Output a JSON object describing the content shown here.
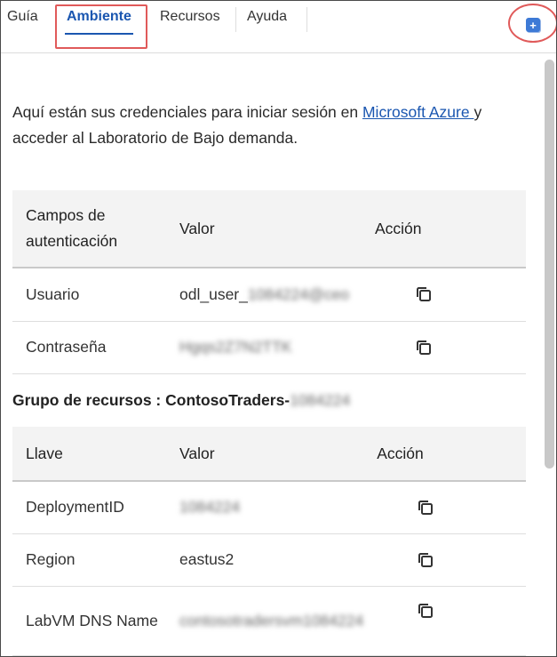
{
  "tabs": [
    {
      "label": "Guía"
    },
    {
      "label": "Ambiente"
    },
    {
      "label": "Recursos"
    },
    {
      "label": "Ayuda"
    }
  ],
  "add_button_label": "+",
  "intro": {
    "text_before": "Aquí están sus credenciales para iniciar sesión en ",
    "link_text": "Microsoft Azure ",
    "text_after": "y acceder al Laboratorio de Bajo demanda."
  },
  "auth_table": {
    "headers": [
      "Campos de autenticación",
      "Valor",
      "Acción"
    ],
    "rows": [
      {
        "field": "Usuario",
        "value_visible": "odl_user_",
        "value_hidden": "1084224@ceo"
      },
      {
        "field": "Contraseña",
        "value_visible": "",
        "value_hidden": "Hgqs2Z7N2TTK"
      }
    ]
  },
  "resource_group": {
    "title_prefix": "Grupo de recursos : ContosoTraders-",
    "title_hidden": "1084224"
  },
  "resource_table": {
    "headers": [
      "Llave",
      "Valor",
      "Acción"
    ],
    "rows": [
      {
        "key": "DeploymentID",
        "value_visible": "",
        "value_hidden": "1084224"
      },
      {
        "key": "Region",
        "value_visible": "eastus2",
        "value_hidden": ""
      },
      {
        "key": "LabVM DNS Name",
        "value_visible": "",
        "value_hidden": "contosotradersvm1084224"
      }
    ]
  },
  "colors": {
    "accent": "#1a56b0",
    "annotation": "#e05a5a",
    "header_bg": "#f3f3f3"
  }
}
